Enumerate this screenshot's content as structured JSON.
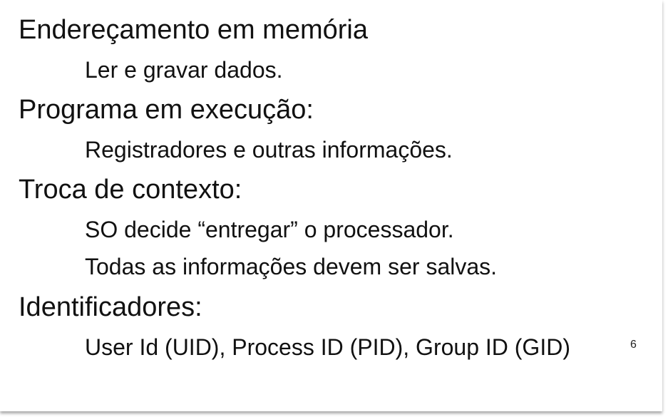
{
  "slide": {
    "items": [
      {
        "level": 1,
        "text": "Endereçamento em memória"
      },
      {
        "level": 2,
        "text": "Ler e gravar dados."
      },
      {
        "level": 1,
        "text": "Programa em execução:"
      },
      {
        "level": 2,
        "text": "Registradores e outras informações."
      },
      {
        "level": 1,
        "text": "Troca de contexto:"
      },
      {
        "level": 2,
        "text": "SO decide “entregar” o processador."
      },
      {
        "level": 2,
        "text": "Todas as informações devem ser salvas."
      },
      {
        "level": 1,
        "text": "Identificadores:"
      },
      {
        "level": 2,
        "text": "User Id (UID), Process ID (PID), Group ID (GID)"
      }
    ],
    "page_number": "6"
  }
}
